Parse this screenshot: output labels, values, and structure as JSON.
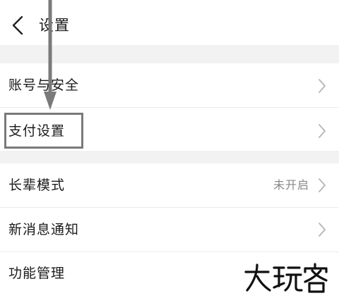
{
  "header": {
    "title": "设置",
    "back_icon": "chevron-left-icon"
  },
  "menu": [
    {
      "label": "账号与安全",
      "value": "",
      "icon": "chevron-right-icon"
    },
    {
      "label": "支付设置",
      "value": "",
      "icon": "chevron-right-icon"
    },
    {
      "label": "长辈模式",
      "value": "未开启",
      "icon": "chevron-right-icon"
    },
    {
      "label": "新消息通知",
      "value": "",
      "icon": "chevron-right-icon"
    },
    {
      "label": "功能管理",
      "value": "",
      "icon": "chevron-right-icon"
    }
  ],
  "annotation": {
    "highlight_color": "#7a7a7a",
    "arrow_color": "#7a7a7a"
  },
  "watermark": {
    "text": "大玩客"
  },
  "colors": {
    "background": "#ffffff",
    "section_gap": "#f2f2f2",
    "text": "#1a1a1a",
    "secondary_text": "#888888",
    "chevron": "#b5b5b5"
  }
}
